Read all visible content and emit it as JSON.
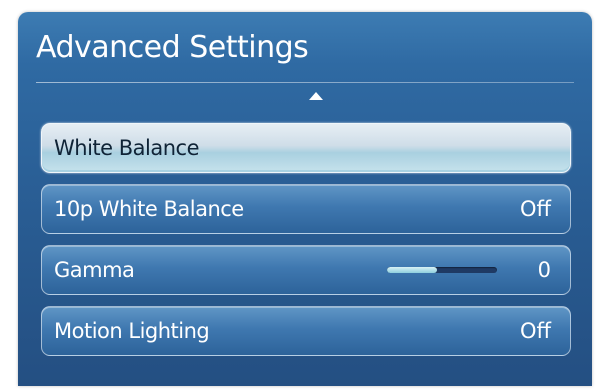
{
  "window": {
    "title": "Advanced Settings"
  },
  "menu": {
    "items": [
      {
        "label": "White Balance",
        "value": null,
        "selected": true
      },
      {
        "label": "10p White Balance",
        "value": "Off",
        "selected": false
      },
      {
        "label": "Gamma",
        "value": "0",
        "selected": false,
        "slider_fraction": 0.45
      },
      {
        "label": "Motion Lighting",
        "value": "Off",
        "selected": false
      }
    ]
  },
  "icons": {
    "scroll_up": "triangle-up-icon"
  },
  "colors": {
    "panel_top": "#3d7cb3",
    "panel_bottom": "#244f82",
    "item_normal": "#3f78b0",
    "item_selected": "#cfdde8",
    "slider_track": "#1f3a64",
    "slider_fill": "#8fd0de",
    "text": "#ffffff"
  }
}
